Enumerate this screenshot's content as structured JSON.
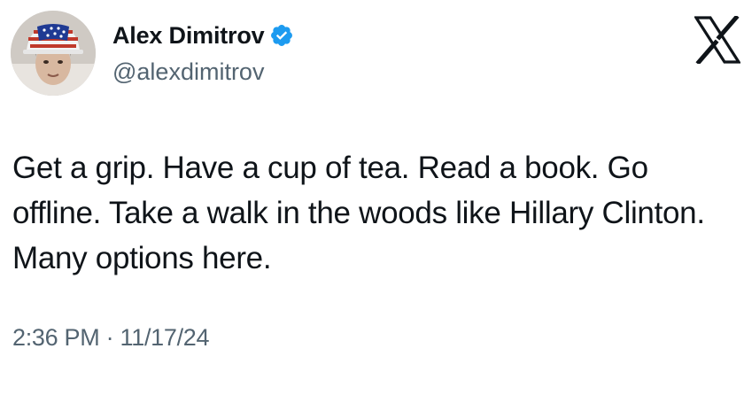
{
  "author": {
    "display_name": "Alex Dimitrov",
    "handle": "@alexdimitrov",
    "verified": true
  },
  "tweet": {
    "text": "Get a grip. Have a cup of tea. Read a book. Go offline. Take a walk in the woods like Hillary Clinton. Many options here.",
    "timestamp": "2:36 PM · 11/17/24"
  },
  "icons": {
    "verified_badge": "verified-badge-icon",
    "platform_logo": "x-logo-icon"
  },
  "colors": {
    "text_primary": "#0f1419",
    "text_secondary": "#536471",
    "verified_blue": "#1d9bf0",
    "background": "#ffffff"
  }
}
